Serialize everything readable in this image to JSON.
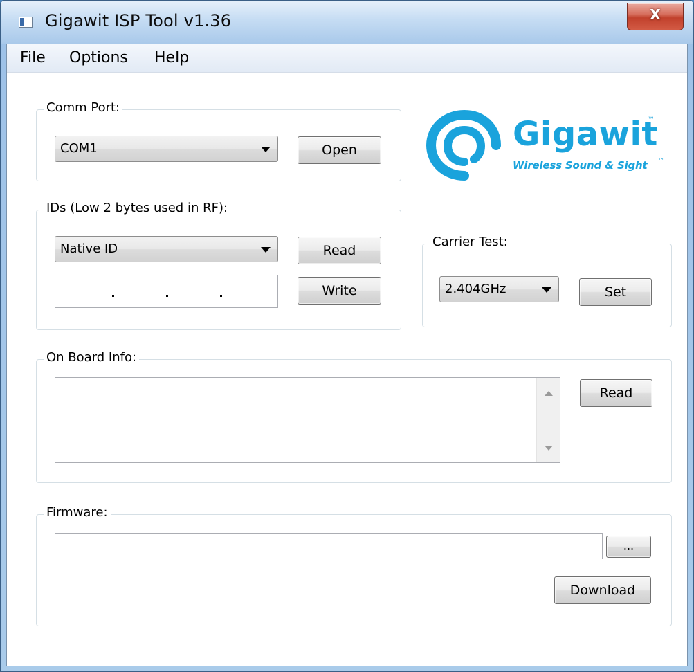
{
  "window": {
    "title": "Gigawit ISP Tool v1.36",
    "close_glyph": "X"
  },
  "menu": {
    "items": [
      "File",
      "Options",
      "Help"
    ]
  },
  "comm_port": {
    "label": "Comm Port:",
    "selected": "COM1",
    "open_button": "Open"
  },
  "logo": {
    "brand": "Gigawit",
    "trademark": "™",
    "tagline": "Wireless Sound & Sight",
    "color": "#1aa3dc"
  },
  "ids": {
    "label": "IDs (Low 2 bytes used in RF):",
    "selected": "Native ID",
    "read_button": "Read",
    "write_button": "Write",
    "id_value": ""
  },
  "carrier_test": {
    "label": "Carrier Test:",
    "selected": "2.404GHz",
    "set_button": "Set"
  },
  "on_board_info": {
    "label": "On Board Info:",
    "text": "",
    "read_button": "Read"
  },
  "firmware": {
    "label": "Firmware:",
    "path": "",
    "browse_button": "...",
    "download_button": "Download"
  }
}
